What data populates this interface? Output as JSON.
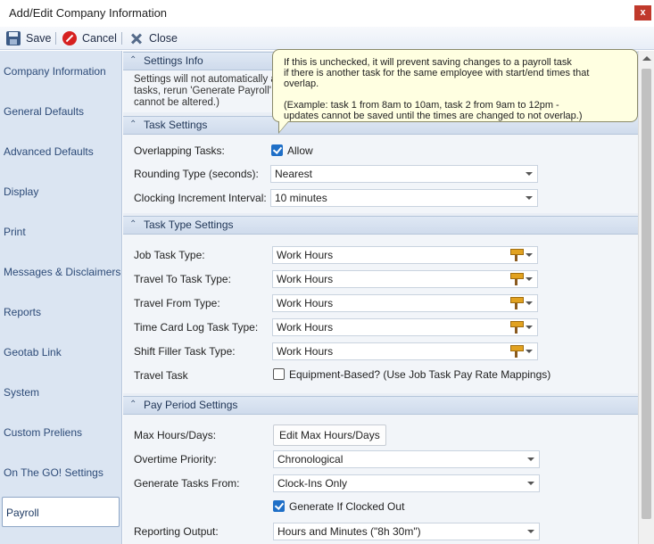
{
  "window": {
    "title": "Add/Edit Company Information",
    "close_glyph": "x"
  },
  "toolbar": {
    "save": "Save",
    "cancel": "Cancel",
    "close": "Close"
  },
  "sidebar": {
    "items": [
      {
        "label": "Company Information"
      },
      {
        "label": "General Defaults"
      },
      {
        "label": "Advanced Defaults"
      },
      {
        "label": "Display"
      },
      {
        "label": "Print"
      },
      {
        "label": "Messages & Disclaimers"
      },
      {
        "label": "Reports"
      },
      {
        "label": "Geotab Link"
      },
      {
        "label": "System"
      },
      {
        "label": "Custom Preliens"
      },
      {
        "label": "On The GO! Settings"
      },
      {
        "label": "Payroll"
      }
    ],
    "active": "Payroll"
  },
  "settings_info": {
    "header": "Settings Info",
    "line1": "Settings will not automatically a",
    "line2": "tasks, rerun 'Generate Payroll' t",
    "line3": "cannot be altered.)"
  },
  "tooltip": {
    "line1": "If this is unchecked, it will prevent saving changes to a payroll task",
    "line2": "if there is another task for the same employee with start/end times that overlap.",
    "line3": "(Example: task 1 from 8am to 10am, task 2 from 9am to 12pm -",
    "line4": "updates cannot be saved until the times are changed to not overlap.)"
  },
  "task_settings": {
    "header": "Task Settings",
    "overlapping_label": "Overlapping Tasks:",
    "overlapping_checkbox": "Allow",
    "overlapping_checked": true,
    "rounding_label": "Rounding Type (seconds):",
    "rounding_value": "Nearest",
    "increment_label": "Clocking Increment Interval:",
    "increment_value": "10 minutes"
  },
  "task_type_settings": {
    "header": "Task Type Settings",
    "job_label": "Job Task Type:",
    "job_value": "Work Hours",
    "travel_to_label": "Travel To Task Type:",
    "travel_to_value": "Work Hours",
    "travel_from_label": "Travel From Type:",
    "travel_from_value": "Work Hours",
    "time_card_label": "Time Card Log Task Type:",
    "time_card_value": "Work Hours",
    "shift_filler_label": "Shift Filler Task Type:",
    "shift_filler_value": "Work Hours",
    "travel_task_label": "Travel Task",
    "travel_task_checkbox": "Equipment-Based? (Use Job Task Pay Rate Mappings)",
    "travel_task_checked": false
  },
  "pay_period_settings": {
    "header": "Pay Period Settings",
    "max_hours_label": "Max Hours/Days:",
    "max_hours_button": "Edit Max Hours/Days",
    "overtime_label": "Overtime Priority:",
    "overtime_value": "Chronological",
    "generate_label": "Generate Tasks From:",
    "generate_value": "Clock-Ins Only",
    "clocked_out_checkbox": "Generate If Clocked Out",
    "clocked_out_checked": true,
    "reporting_label": "Reporting Output:",
    "reporting_value": "Hours and Minutes (\"8h 30m\")"
  },
  "colors": {
    "sidebar_bg": "#dbe5f2",
    "accent": "#1f6fc7",
    "tooltip_bg": "#ffffe1",
    "close_red": "#c0392b"
  },
  "icons": {
    "save": "floppy-disk-icon",
    "cancel": "cancel-circle-icon",
    "close": "x-close-icon",
    "task_type": "tool-hammer-icon"
  }
}
